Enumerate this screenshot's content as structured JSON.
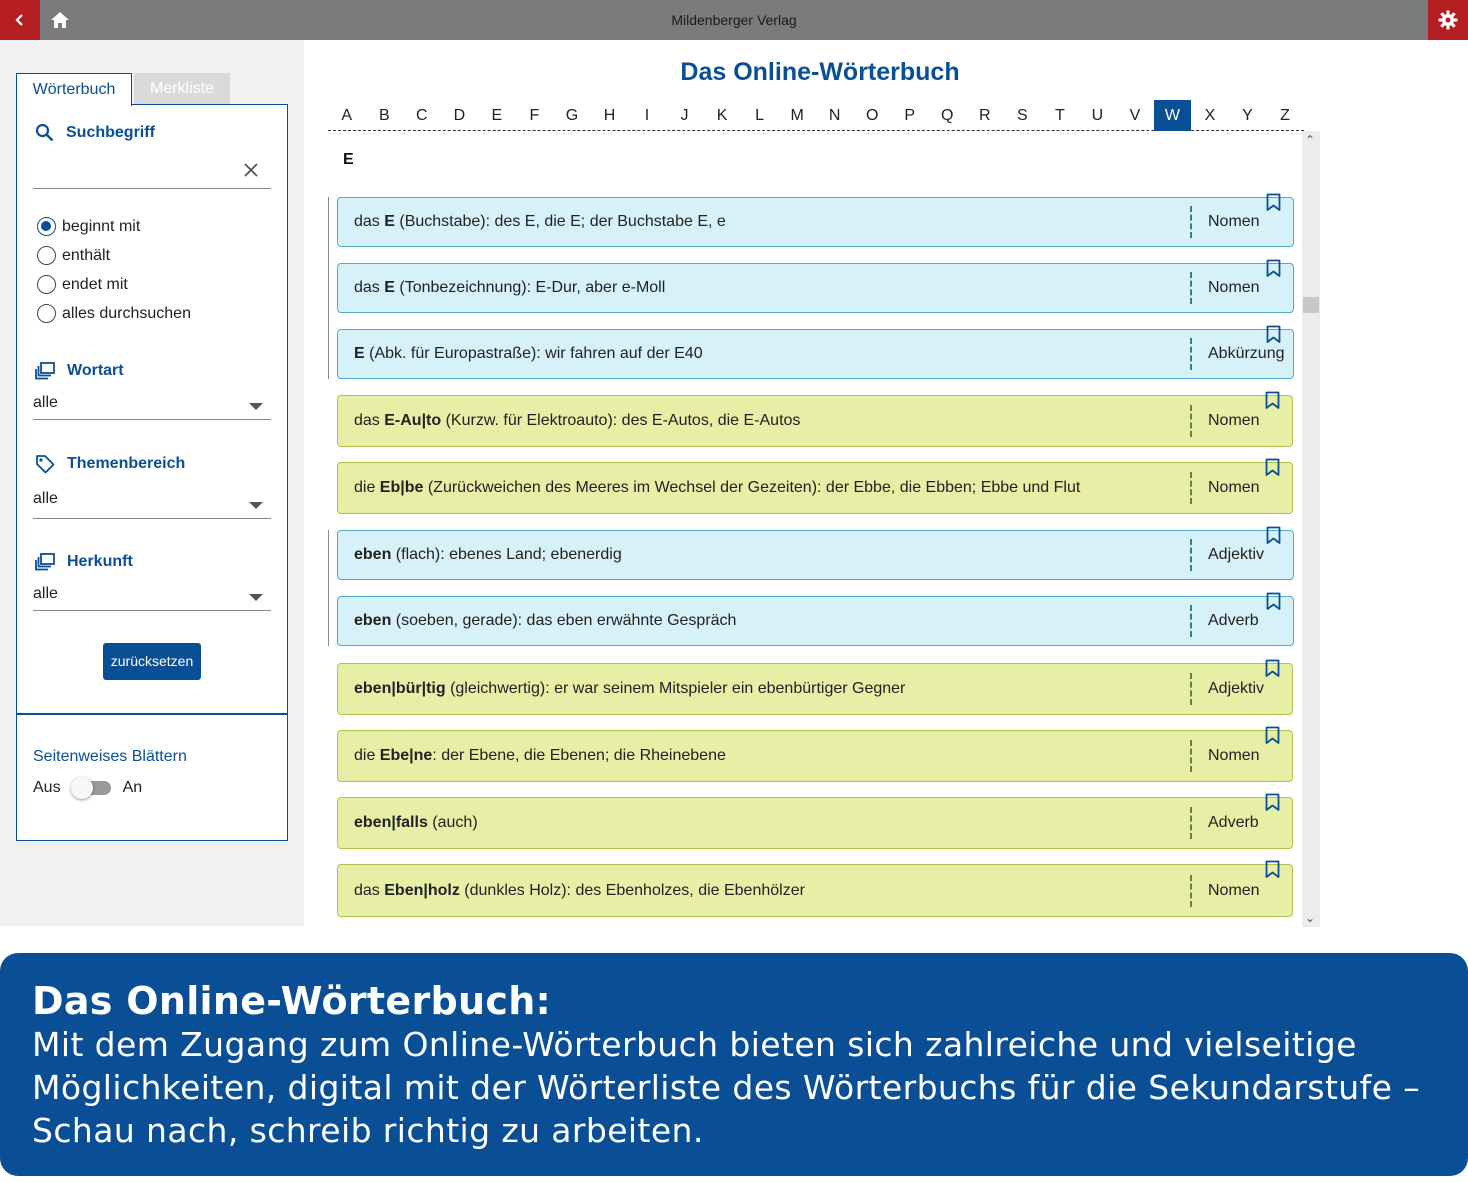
{
  "header": {
    "app_title": "Mildenberger Verlag",
    "icons": {
      "back": "chevron-left-icon",
      "home": "home-icon",
      "settings": "gear-icon"
    },
    "accent_color": "#b51f23"
  },
  "sidebar": {
    "tabs": [
      {
        "label": "Wörterbuch",
        "active": true
      },
      {
        "label": "Merkliste",
        "active": false
      }
    ],
    "search": {
      "heading": "Suchbegriff",
      "value": "",
      "placeholder": ""
    },
    "match_options": [
      {
        "label": "beginnt mit",
        "checked": true
      },
      {
        "label": "enthält",
        "checked": false
      },
      {
        "label": "endet mit",
        "checked": false
      },
      {
        "label": "alles durchsuchen",
        "checked": false
      }
    ],
    "wortart": {
      "heading": "Wortart",
      "value": "alle"
    },
    "themenbereich": {
      "heading": "Themenbereich",
      "value": "alle"
    },
    "herkunft": {
      "heading": "Herkunft",
      "value": "alle"
    },
    "reset_label": "zurücksetzen",
    "paging": {
      "label": "Seitenweises Blättern",
      "off_label": "Aus",
      "on_label": "An",
      "enabled": false
    }
  },
  "main": {
    "title": "Das Online-Wörterbuch",
    "alphabet": [
      "A",
      "B",
      "C",
      "D",
      "E",
      "F",
      "G",
      "H",
      "I",
      "J",
      "K",
      "L",
      "M",
      "N",
      "O",
      "P",
      "Q",
      "R",
      "S",
      "T",
      "U",
      "V",
      "W",
      "X",
      "Y",
      "Z"
    ],
    "active_letter": "W",
    "section_letter": "E",
    "entries": [
      {
        "pre": "das ",
        "word": "E",
        "rest": " (Buchstabe): des E, die E; der Buchstabe E, e",
        "pos": "Nomen",
        "color": "blue"
      },
      {
        "pre": "das ",
        "word": "E",
        "rest": " (Tonbezeichnung): E-Dur, aber e-Moll",
        "pos": "Nomen",
        "color": "blue"
      },
      {
        "pre": "",
        "word": "E",
        "rest": " (Abk. für Europastraße): wir fahren auf der E40",
        "pos": "Abkürzung",
        "color": "blue"
      },
      {
        "pre": "das ",
        "word": "E-Au|to",
        "rest": " (Kurzw. für Elektroauto): des E-Autos, die E-Autos",
        "pos": "Nomen",
        "color": "yellow"
      },
      {
        "pre": "die ",
        "word": "Eb|be",
        "rest": " (Zurückweichen des Meeres im Wechsel der Gezeiten): der Ebbe, die Ebben; Ebbe und Flut",
        "pos": "Nomen",
        "color": "yellow"
      },
      {
        "pre": "",
        "word": "eben",
        "rest": " (flach): ebenes Land; ebenerdig",
        "pos": "Adjektiv",
        "color": "blue"
      },
      {
        "pre": "",
        "word": "eben",
        "rest": " (soeben, gerade): das eben erwähnte Gespräch",
        "pos": "Adverb",
        "color": "blue"
      },
      {
        "pre": "",
        "word": "eben|bür|tig",
        "rest": " (gleichwertig): er war seinem Mitspieler ein ebenbürtiger Gegner",
        "pos": "Adjektiv",
        "color": "yellow"
      },
      {
        "pre": "die ",
        "word": "Ebe|ne",
        "rest": ": der Ebene, die Ebenen; die Rheinebene",
        "pos": "Nomen",
        "color": "yellow"
      },
      {
        "pre": "",
        "word": "eben|falls",
        "rest": " (auch)",
        "pos": "Adverb",
        "color": "yellow"
      },
      {
        "pre": "das ",
        "word": "Eben|holz",
        "rest": " (dunkles Holz): des Ebenholzes, die Ebenhölzer",
        "pos": "Nomen",
        "color": "yellow"
      }
    ]
  },
  "banner": {
    "title": "Das Online-Wörterbuch:",
    "lines": [
      "Mit dem Zugang zum Online-Wörterbuch bieten sich zahlreiche und vielseitige",
      "Möglichkeiten, digital mit der Wörterliste des Wörterbuchs für die Sekundarstufe –",
      "Schau nach, schreib richtig zu arbeiten."
    ]
  },
  "colors": {
    "brand": "#0a4f95",
    "entry_blue": "#d6f1f7",
    "entry_yellow": "#e7efa6"
  }
}
